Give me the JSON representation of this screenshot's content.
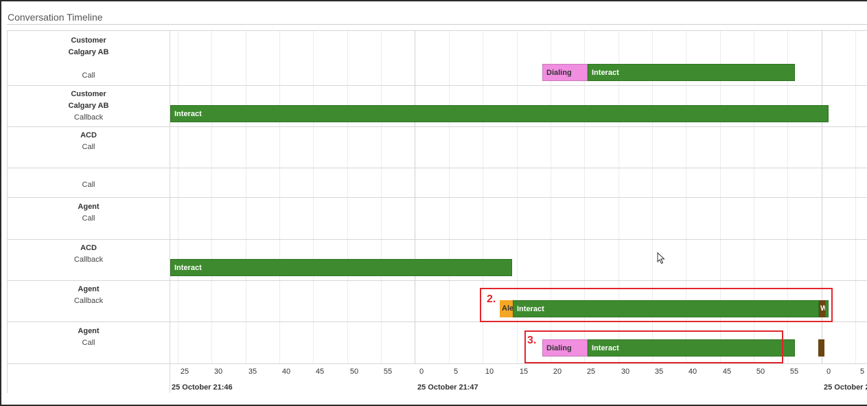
{
  "title": "Conversation Timeline",
  "rows": [
    {
      "line1": "Customer",
      "line2": "Calgary AB",
      "line3": "Call"
    },
    {
      "line1": "Customer",
      "line2": "Calgary AB",
      "line3": "Callback"
    },
    {
      "line1": "ACD",
      "line2": "",
      "line3": "Call"
    },
    {
      "line1": "",
      "line2": "",
      "line3": "Call"
    },
    {
      "line1": "Agent",
      "line2": "",
      "line3": "Call"
    },
    {
      "line1": "ACD",
      "line2": "",
      "line3": "Callback"
    },
    {
      "line1": "Agent",
      "line2": "",
      "line3": "Callback"
    },
    {
      "line1": "Agent",
      "line2": "",
      "line3": "Call"
    }
  ],
  "bars": {
    "dialing": "Dialing",
    "interact": "Interact",
    "alert": "Ale",
    "wrap": "W"
  },
  "axis": {
    "ticks": [
      "25",
      "30",
      "35",
      "40",
      "45",
      "50",
      "55",
      "0",
      "5",
      "10",
      "15",
      "20",
      "25",
      "30",
      "35",
      "40",
      "45",
      "50",
      "55",
      "0",
      "5"
    ],
    "dates": [
      "25 October 21:46",
      "25 October 21:47",
      "25 October 2"
    ]
  },
  "annotations": {
    "n2": "2.",
    "n3": "3."
  },
  "colors": {
    "interact": "#3d8b2e",
    "dialing": "#f18ee0",
    "alert": "#f5a623",
    "wrap": "#6b4512",
    "highlight": "#e0262c"
  }
}
